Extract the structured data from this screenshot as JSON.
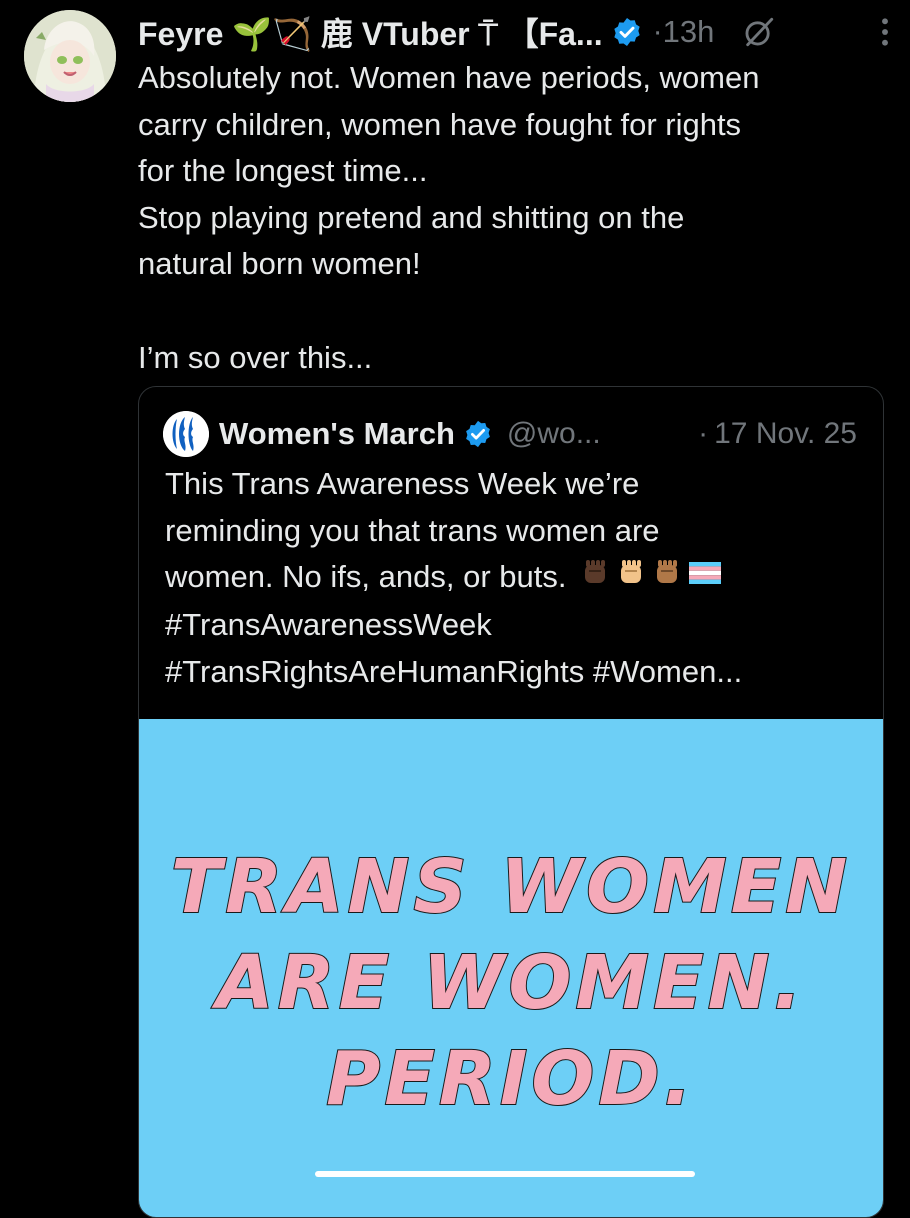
{
  "post": {
    "author_name": "Feyre 🌱🏹 鹿 VTuber ⍑ 【Fa...",
    "time": "13h",
    "separator": "·",
    "lines": [
      "Absolutely not. Women have periods, women",
      "carry children, women have fought for rights",
      "for the longest time...",
      "Stop playing pretend and shitting on the",
      "natural born women!",
      "I’m so over this..."
    ],
    "icons": {
      "verified": "verified-badge-icon",
      "grok": "grok-icon",
      "more": "more-vertical-icon"
    },
    "colors": {
      "verified": "#1d9bf0",
      "muted": "#71767b",
      "text": "#e7e9ea"
    }
  },
  "quote": {
    "author_name": "Women's March",
    "handle": "@wo...",
    "separator": "·",
    "date": "17 Nov. 25",
    "lines": [
      "This Trans Awareness Week we’re",
      "reminding you that trans women are",
      "women. No ifs, ands, or buts.",
      "#TransAwarenessWeek",
      "#TransRightsAreHumanRights #Women..."
    ],
    "emojis": [
      "raised-fist-dark-emoji",
      "raised-fist-light-emoji",
      "raised-fist-medium-emoji",
      "transgender-flag-emoji"
    ],
    "image": {
      "lines": [
        "TRANS WOMEN",
        "ARE WOMEN.",
        "PERIOD."
      ],
      "background": "#6dcff6",
      "text_color": "#f5a9b8"
    }
  }
}
